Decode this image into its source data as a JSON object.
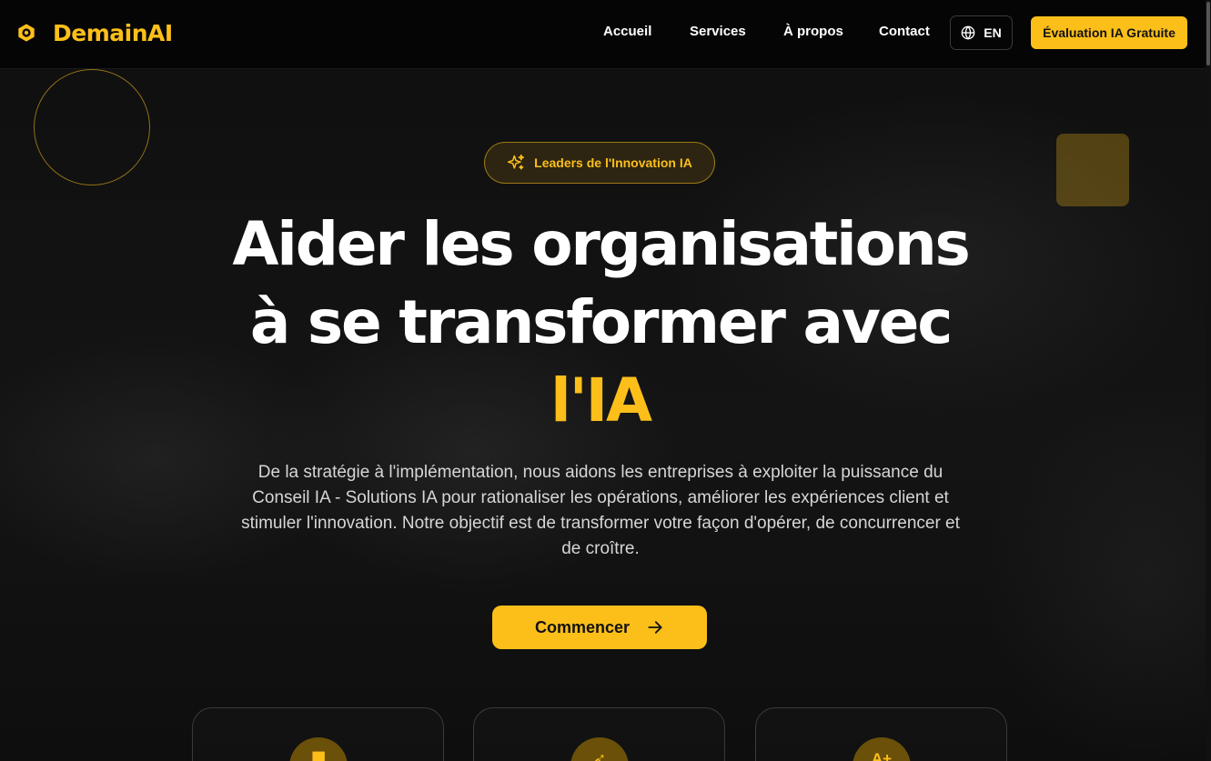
{
  "brand": {
    "name": "DemainAI",
    "icon": "hexagon-gear-icon"
  },
  "nav": {
    "items": [
      "Accueil",
      "Services",
      "À propos",
      "Contact"
    ],
    "language": "EN",
    "cta": "Évaluation IA Gratuite"
  },
  "hero": {
    "badge": "Leaders de l'Innovation IA",
    "title_line1": "Aider les organisations",
    "title_line2": "à se transformer avec",
    "title_accent": "l'IA",
    "subtitle": "De la stratégie à l'implémentation, nous aidons les entreprises à exploiter la puissance du Conseil IA - Solutions IA pour rationaliser les opérations, améliorer les expériences client et stimuler l'innovation. Notre objectif est de transformer votre façon d'opérer, de concurrencer et de croître.",
    "button": "Commencer"
  },
  "stats": [
    {
      "icon": "bars-icon",
      "glyph": "▇"
    },
    {
      "icon": "rocket-icon",
      "glyph": "➶"
    },
    {
      "icon": "grade-icon",
      "glyph": "A+"
    }
  ],
  "colors": {
    "accent": "#fcbf1a",
    "background": "#0a0a0a"
  }
}
